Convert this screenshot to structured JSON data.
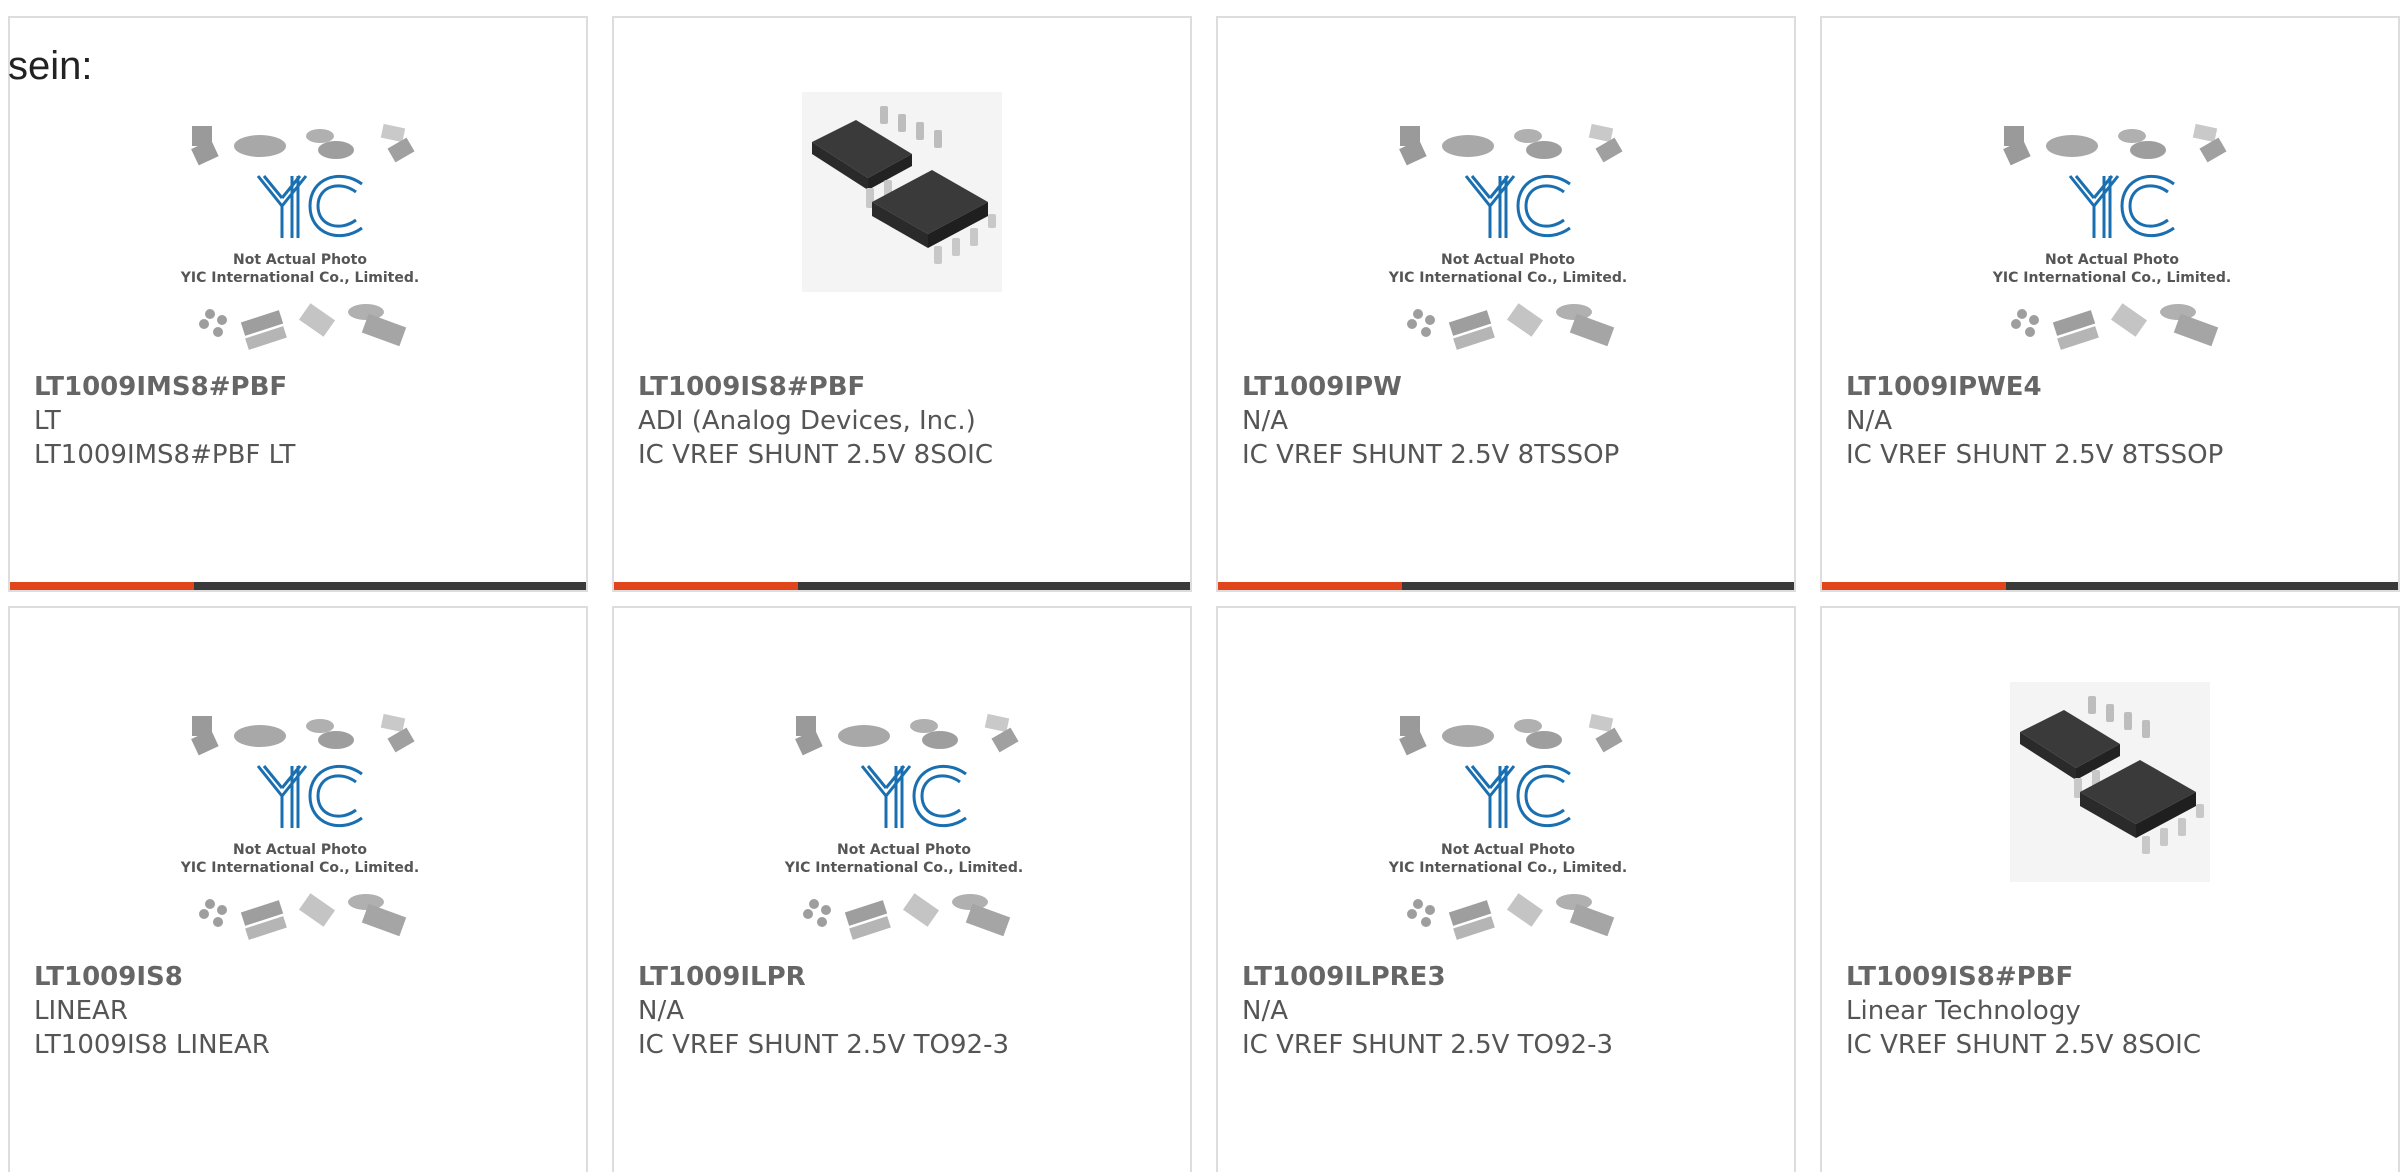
{
  "intro_text": "sein:",
  "image_text": {
    "line1": "Not Actual Photo",
    "line2": "YIC International Co., Limited."
  },
  "colors": {
    "accent": "#e0451c",
    "bar": "#3a3a3a",
    "logo": "#1a6fb0",
    "border": "#dddddd"
  },
  "products": [
    {
      "part": "LT1009IMS8#PBF",
      "brand": "LT",
      "desc": "LT1009IMS8#PBF LT",
      "image": "placeholder-icon"
    },
    {
      "part": "LT1009IS8#PBF",
      "brand": "ADI (Analog Devices, Inc.)",
      "desc": "IC VREF SHUNT 2.5V 8SOIC",
      "image": "soic-chip-photo"
    },
    {
      "part": "LT1009IPW",
      "brand": "N/A",
      "desc": "IC VREF SHUNT 2.5V 8TSSOP",
      "image": "placeholder-icon"
    },
    {
      "part": "LT1009IPWE4",
      "brand": "N/A",
      "desc": "IC VREF SHUNT 2.5V 8TSSOP",
      "image": "placeholder-icon"
    },
    {
      "part": "LT1009IS8",
      "brand": "LINEAR",
      "desc": "LT1009IS8 LINEAR",
      "image": "placeholder-icon"
    },
    {
      "part": "LT1009ILPR",
      "brand": "N/A",
      "desc": "IC VREF SHUNT 2.5V TO92-3",
      "image": "placeholder-icon"
    },
    {
      "part": "LT1009ILPRE3",
      "brand": "N/A",
      "desc": "IC VREF SHUNT 2.5V TO92-3",
      "image": "placeholder-icon"
    },
    {
      "part": "LT1009IS8#PBF",
      "brand": "Linear Technology",
      "desc": "IC VREF SHUNT 2.5V 8SOIC",
      "image": "soic-chip-photo"
    }
  ]
}
